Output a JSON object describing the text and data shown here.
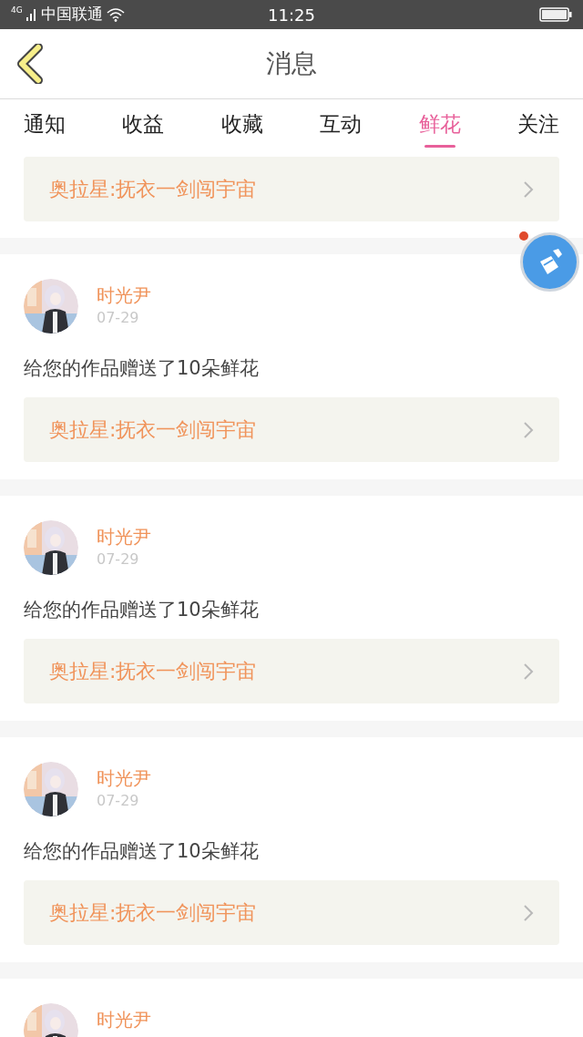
{
  "status_bar": {
    "network": "4G",
    "carrier": "中国联通",
    "time": "11:25"
  },
  "header": {
    "title": "消息"
  },
  "tabs": [
    {
      "label": "通知",
      "selected": false
    },
    {
      "label": "收益",
      "selected": false
    },
    {
      "label": "收藏",
      "selected": false
    },
    {
      "label": "互动",
      "selected": false
    },
    {
      "label": "鲜花",
      "selected": true
    },
    {
      "label": "关注",
      "selected": false
    }
  ],
  "messages": [
    {
      "kind": "partial",
      "link": "奥拉星:抚衣一剑闯宇宙"
    },
    {
      "kind": "full",
      "name": "时光尹",
      "date": "07-29",
      "text": "给您的作品赠送了10朵鲜花",
      "link": "奥拉星:抚衣一剑闯宇宙"
    },
    {
      "kind": "full",
      "name": "时光尹",
      "date": "07-29",
      "text": "给您的作品赠送了10朵鲜花",
      "link": "奥拉星:抚衣一剑闯宇宙"
    },
    {
      "kind": "full",
      "name": "时光尹",
      "date": "07-29",
      "text": "给您的作品赠送了10朵鲜花",
      "link": "奥拉星:抚衣一剑闯宇宙"
    },
    {
      "kind": "full",
      "name": "时光尹"
    }
  ],
  "floating_button": {
    "notification": true
  }
}
